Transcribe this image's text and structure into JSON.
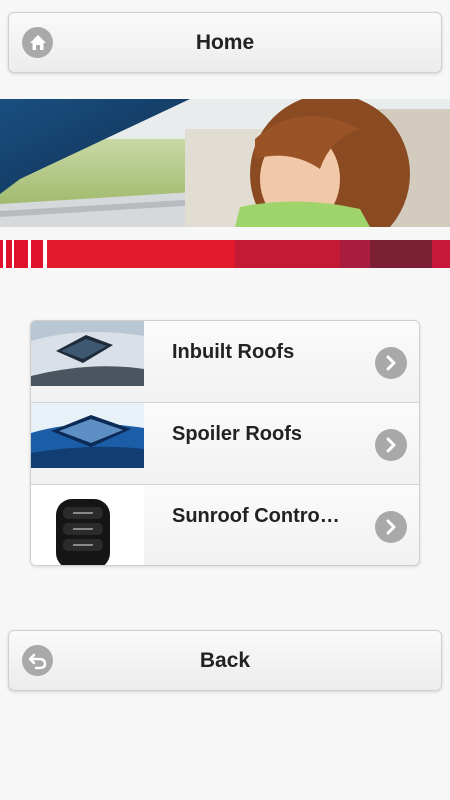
{
  "header": {
    "home_label": "Home",
    "home_icon": "home-icon"
  },
  "banner": {
    "image": "woman-in-car-photo"
  },
  "menu": {
    "items": [
      {
        "label": "Inbuilt Roofs",
        "thumbnail": "inbuilt-roof-photo",
        "icon": "chevron-right-icon"
      },
      {
        "label": "Spoiler Roofs",
        "thumbnail": "spoiler-roof-photo",
        "icon": "chevron-right-icon"
      },
      {
        "label": "Sunroof Contro…",
        "thumbnail": "sunroof-remote-photo",
        "icon": "chevron-right-icon"
      }
    ]
  },
  "footer": {
    "back_label": "Back",
    "back_icon": "back-arrow-icon"
  },
  "colors": {
    "accent_red": "#e21a2b",
    "icon_gray": "#a9a9a9",
    "background": "#f7f7f7"
  }
}
